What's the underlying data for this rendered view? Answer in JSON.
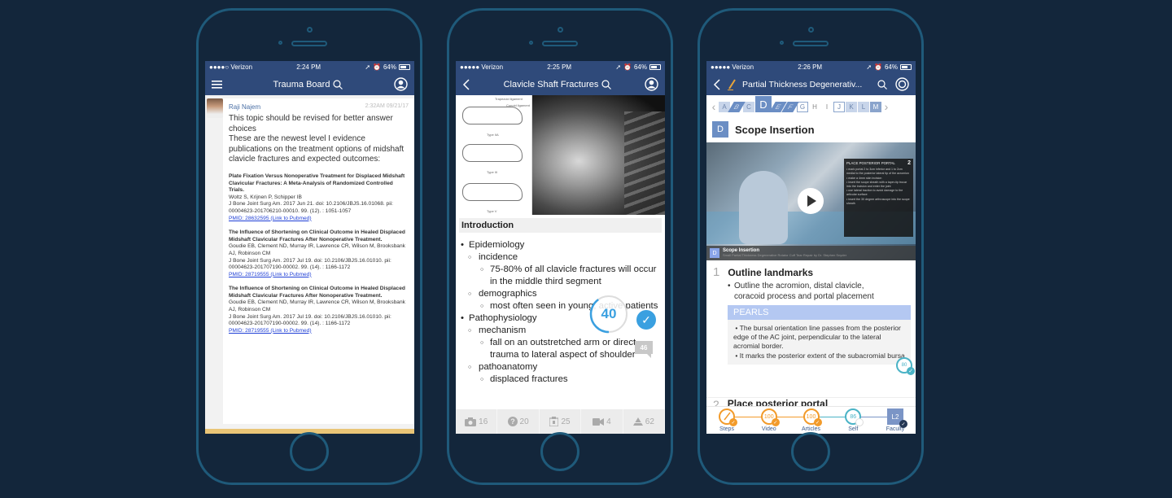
{
  "colors": {
    "background": "#13263b",
    "phone_outline": "#1f5a7a",
    "navbar": "#2f4a7a",
    "accent_blue": "#3aa0e0",
    "orange": "#f29b2b",
    "teal": "#4ab3c6",
    "link": "#1f3fd6",
    "bottom_strip": "#e9c577"
  },
  "phones": [
    {
      "status": {
        "carrier": "●●●●○ Verizon",
        "time": "2:24 PM",
        "battery": "64%"
      },
      "nav": {
        "title": "Trauma Board",
        "left_icon": "hamburger-menu-icon",
        "right_icon": "profile-icon"
      },
      "post": {
        "author": "Raji Najem",
        "time": "2:32AM 09/21/17",
        "body_line1": "This topic should be revised for better answer choices",
        "body_line2": "These are the newest level I evidence publications on the treatment options of midshaft clavicle fractures and expected outcomes:",
        "references": [
          {
            "title": "Plate Fixation Versus Nonoperative Treatment for Displaced Midshaft Clavicular Fractures: A Meta-Analysis of Randomized Controlled Trials.",
            "authors": "Woltz S, Krijnen P, Schipper IB",
            "citation": "J Bone Joint Surg Am. 2017 Jun 21. doi: 10.2106/JBJS.16.01068. pii: 00004623-201706210-00010. 99. (12). : 1051-1057",
            "link": "PMID: 28632595 (Link to Pubmed)"
          },
          {
            "title": "The Influence of Shortening on Clinical Outcome in Healed Displaced Midshaft Clavicular Fractures After Nonoperative Treatment.",
            "authors": "Goudie EB, Clement ND, Murray IR, Lawrence CR, Wilson M, Brooksbank AJ, Robinson CM",
            "citation": "J Bone Joint Surg Am. 2017 Jul 19. doi: 10.2106/JBJS.16.01010. pii: 00004623-201707190-00002. 99. (14). : 1166-1172",
            "link": "PMID: 28719555 (Link to Pubmed)"
          },
          {
            "title": "The Influence of Shortening on Clinical Outcome in Healed Displaced Midshaft Clavicular Fractures After Nonoperative Treatment.",
            "authors": "Goudie EB, Clement ND, Murray IR, Lawrence CR, Wilson M, Brooksbank AJ, Robinson CM",
            "citation": "J Bone Joint Surg Am. 2017 Jul 19. doi: 10.2106/JBJS.16.01010. pii: 00004623-201707190-00002. 99. (14). : 1166-1172",
            "link": "PMID: 28719555 (Link to Pubmed)"
          }
        ]
      }
    },
    {
      "status": {
        "carrier": "●●●●● Verizon",
        "time": "2:25 PM",
        "battery": "64%"
      },
      "nav": {
        "title": "Clavicle Shaft Fractures",
        "left_icon": "back-chevron-icon",
        "right_icon": "profile-icon"
      },
      "diagram_labels": [
        "Trapezoid ligament",
        "Conoid ligament",
        "Type IIA",
        "Type III",
        "Type V"
      ],
      "section_title": "Introduction",
      "outline": {
        "l1_a": "Epidemiology",
        "l2_a": "incidence",
        "l3_a": "75-80% of all clavicle fractures will occur in the middle third segment",
        "l2_b": "demographics",
        "l3_b": "most often seen in young, active patients",
        "l1_b": "Pathophysiology",
        "l2_c": "mechanism",
        "l3_c": "fall on an outstretched arm or direct trauma to lateral aspect of shoulder",
        "l2_d": "pathoanatomy",
        "l3_d": "displaced fractures"
      },
      "progress": {
        "value": 40,
        "fraction": 0.4
      },
      "comment_count": "46",
      "tabs": [
        {
          "icon": "camera-icon",
          "count": "16"
        },
        {
          "icon": "question-icon",
          "count": "20"
        },
        {
          "icon": "building-icon",
          "count": "25"
        },
        {
          "icon": "video-camera-icon",
          "count": "4"
        },
        {
          "icon": "pyramid-icon",
          "count": "62"
        }
      ]
    },
    {
      "status": {
        "carrier": "●●●●● Verizon",
        "time": "2:26 PM",
        "battery": "64%"
      },
      "nav": {
        "title": "Partial Thickness Degenerativ...",
        "left_icon": "back-chevron-icon",
        "right_icon": "target-icon"
      },
      "alphabet": [
        "A",
        "B",
        "C",
        "D",
        "E",
        "F",
        "G",
        "H",
        "I",
        "J",
        "K",
        "L",
        "M"
      ],
      "current_letter": "D",
      "step_title": "Scope Insertion",
      "video": {
        "overlay_title": "PLACE POSTERIOR PORTAL",
        "overlay_num": "2",
        "overlay_items": [
          "mark portal 2 to 3cm inferior and 1 to 2cm medial to the posterior lateral tip of the acromion",
          "make a 4mm skin incision",
          "insert the scope sheath with a taper-tip trocar into the incision and enter the joint",
          "use lateral traction to avoid damage to the articular surface",
          "insert the 30 degree arthroscope into the scope sheath"
        ],
        "caption_letter": "D",
        "caption_title": "Scope Insertion",
        "caption_sub": "Small Partial Thickness Degenerative Rotator Cuff Tear Repair by Dr. Stephen Snyder"
      },
      "steps": [
        {
          "num": "1",
          "title": "Outline landmarks",
          "bullet": "Outline the acromion, distal clavicle, coracoid process and portal placement",
          "score": "80"
        },
        {
          "num": "2",
          "title": "Place posterior portal"
        }
      ],
      "pearls": {
        "heading": "PEARLS",
        "items": [
          "The bursal orientation line passes from the posterior edge of the AC joint, perpendicular to the lateral acromial border.",
          "It marks the posterior extent of the subacromial bursa"
        ]
      },
      "footer": [
        {
          "label": "Steps",
          "value": "",
          "icon": "pencil-icon"
        },
        {
          "label": "Video",
          "value": "100"
        },
        {
          "label": "Articles",
          "value": "100"
        },
        {
          "label": "Self",
          "value": "86"
        },
        {
          "label": "Faculty",
          "value": "L2"
        }
      ]
    }
  ]
}
